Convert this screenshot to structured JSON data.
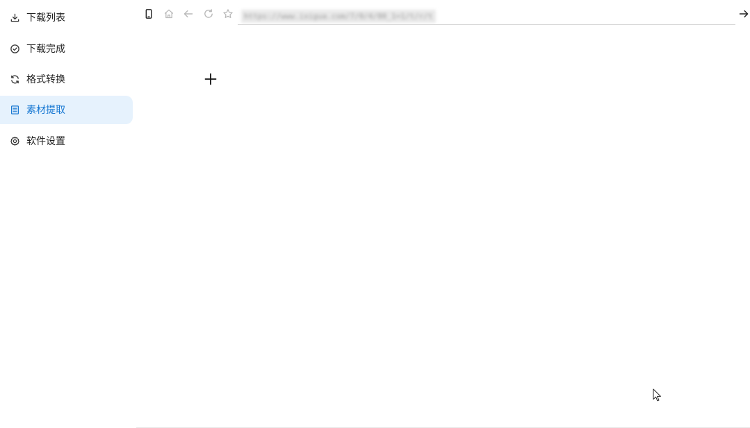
{
  "sidebar": {
    "items": [
      {
        "label": "下载列表",
        "icon": "download-icon"
      },
      {
        "label": "下载完成",
        "icon": "check-circle-icon"
      },
      {
        "label": "格式转换",
        "icon": "refresh-icon"
      },
      {
        "label": "素材提取",
        "icon": "document-icon",
        "active": true
      },
      {
        "label": "软件设置",
        "icon": "gear-icon"
      }
    ]
  },
  "toolbar": {
    "url": "https://www.ixigua.com/7/0/4/80_1=1/t/r/t"
  },
  "colors": {
    "active_bg": "#e6f2fd",
    "active_text": "#1677d2"
  }
}
